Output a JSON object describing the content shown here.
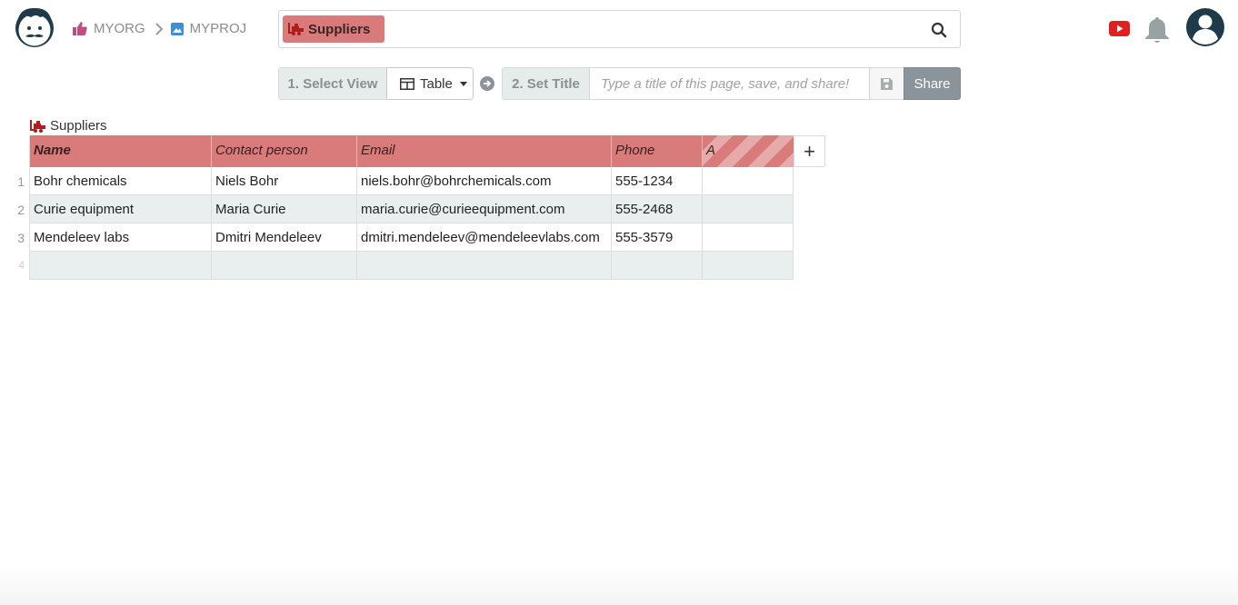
{
  "header": {
    "breadcrumb": [
      {
        "label": "MYORG",
        "icon": "thumbs-up-icon"
      },
      {
        "label": "MYPROJ",
        "icon": "image-icon"
      }
    ],
    "search_chip": "Suppliers",
    "icons": [
      "avatar-logo-icon",
      "youtube-icon",
      "bell-icon",
      "user-circle-icon",
      "search-icon"
    ]
  },
  "toolbar": {
    "step1_label": "1. Select View",
    "view_selected": "Table",
    "step2_label": "2. Set Title",
    "title_placeholder": "Type a title of this page, save, and share!",
    "title_value": "",
    "share_label": "Share"
  },
  "table": {
    "caption": "Suppliers",
    "columns": [
      "Name",
      "Contact person",
      "Email",
      "Phone",
      "A"
    ],
    "add_column_label": "+",
    "rows": [
      {
        "num": "1",
        "cells": [
          "Bohr chemicals",
          "Niels Bohr",
          "niels.bohr@bohrchemicals.com",
          "555-1234",
          ""
        ]
      },
      {
        "num": "2",
        "cells": [
          "Curie equipment",
          "Maria Curie",
          "maria.curie@curieequipment.com",
          "555-2468",
          ""
        ]
      },
      {
        "num": "3",
        "cells": [
          "Mendeleev labs",
          "Dmitri Mendeleev",
          "dmitri.mendeleev@mendeleevlabs.com",
          "555-3579",
          ""
        ]
      },
      {
        "num": "4",
        "cells": [
          "",
          "",
          "",
          "",
          ""
        ]
      }
    ]
  },
  "colors": {
    "header_bg": "#d97b7b",
    "alt_row_bg": "#e9efef",
    "share_bg": "#8a949a",
    "youtube_red": "#e21f1f"
  }
}
